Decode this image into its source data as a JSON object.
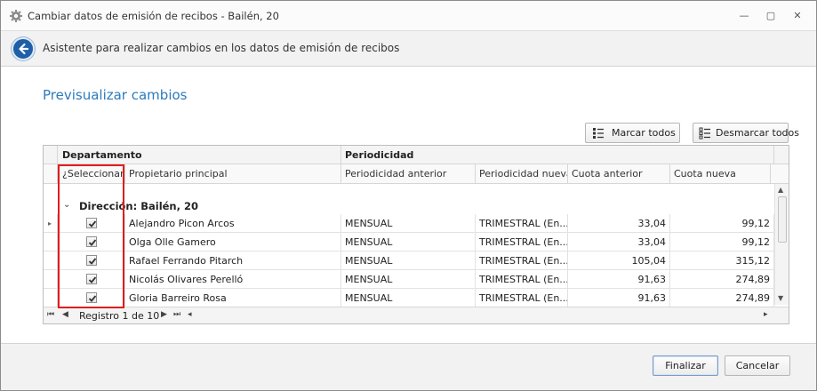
{
  "window": {
    "title": "Cambiar datos de emisión de recibos - Bailén, 20",
    "controls": {
      "minimize": "—",
      "maximize": "▢",
      "close": "✕"
    }
  },
  "header": {
    "subtitle": "Asistente para realizar cambios en los datos de emisión de recibos"
  },
  "section_title": "Previsualizar cambios",
  "toolbar": {
    "select_all_label": "Marcar todos",
    "deselect_all_label": "Desmarcar todos"
  },
  "grid": {
    "bands": {
      "departamento": "Departamento",
      "periodicidad": "Periodicidad"
    },
    "columns": {
      "seleccionar": "¿Seleccionar?",
      "propietario": "Propietario principal",
      "periodicidad_anterior": "Periodicidad anterior",
      "periodicidad_nueva": "Periodicidad nueva",
      "cuota_anterior": "Cuota anterior",
      "cuota_nueva": "Cuota nueva"
    },
    "group_label": "Dirección: Bailén, 20",
    "rows": [
      {
        "checked": true,
        "propietario": "Alejandro Picon Arcos",
        "periodicidad_anterior": "MENSUAL",
        "periodicidad_nueva": "TRIMESTRAL (En...",
        "cuota_anterior": "33,04",
        "cuota_nueva": "99,12"
      },
      {
        "checked": true,
        "propietario": "Olga Olle Gamero",
        "periodicidad_anterior": "MENSUAL",
        "periodicidad_nueva": "TRIMESTRAL (En...",
        "cuota_anterior": "33,04",
        "cuota_nueva": "99,12"
      },
      {
        "checked": true,
        "propietario": "Rafael Ferrando Pitarch",
        "periodicidad_anterior": "MENSUAL",
        "periodicidad_nueva": "TRIMESTRAL (En...",
        "cuota_anterior": "105,04",
        "cuota_nueva": "315,12"
      },
      {
        "checked": true,
        "propietario": "Nicolás Olivares Perelló",
        "periodicidad_anterior": "MENSUAL",
        "periodicidad_nueva": "TRIMESTRAL (En...",
        "cuota_anterior": "91,63",
        "cuota_nueva": "274,89"
      },
      {
        "checked": true,
        "propietario": "Gloria Barreiro Rosa",
        "periodicidad_anterior": "MENSUAL",
        "periodicidad_nueva": "TRIMESTRAL (En...",
        "cuota_anterior": "91,63",
        "cuota_nueva": "274,89"
      }
    ],
    "navigator": {
      "record_label": "Registro 1 de 10"
    }
  },
  "footer": {
    "finish_label": "Finalizar",
    "cancel_label": "Cancelar"
  },
  "colors": {
    "accent_title": "#2b7bbd",
    "back_button": "#1f5fa8",
    "highlight_border": "#e01d1d"
  },
  "icons": [
    "gear-icon",
    "back-arrow-icon",
    "list-check-icon",
    "chevron-down-icon",
    "checkbox-checked-icon"
  ]
}
